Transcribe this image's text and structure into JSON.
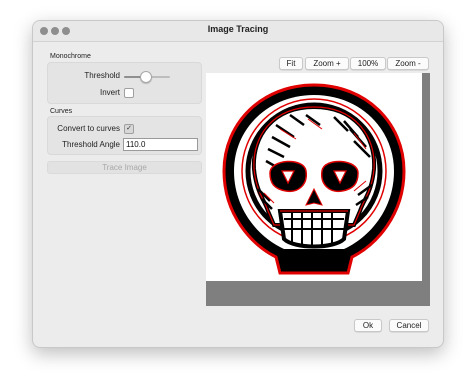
{
  "window": {
    "title": "Image Tracing"
  },
  "monochrome": {
    "section_label": "Monochrome",
    "threshold_label": "Threshold",
    "threshold_value": 0.45,
    "invert_label": "Invert",
    "invert_checked": false
  },
  "curves": {
    "section_label": "Curves",
    "convert_label": "Convert to curves",
    "convert_checked": true,
    "threshold_angle_label": "Threshold Angle",
    "threshold_angle_value": "110.0"
  },
  "actions": {
    "trace_label": "Trace Image",
    "ok_label": "Ok",
    "cancel_label": "Cancel"
  },
  "zoom_toolbar": {
    "fit_label": "Fit",
    "zoom_in_label": "Zoom +",
    "zoom_100_label": "100%",
    "zoom_out_label": "Zoom -"
  },
  "preview": {
    "image_name": "skull-trace-preview",
    "colors": {
      "outline": "#e00000",
      "fill": "#000000",
      "background": "#ffffff"
    }
  }
}
